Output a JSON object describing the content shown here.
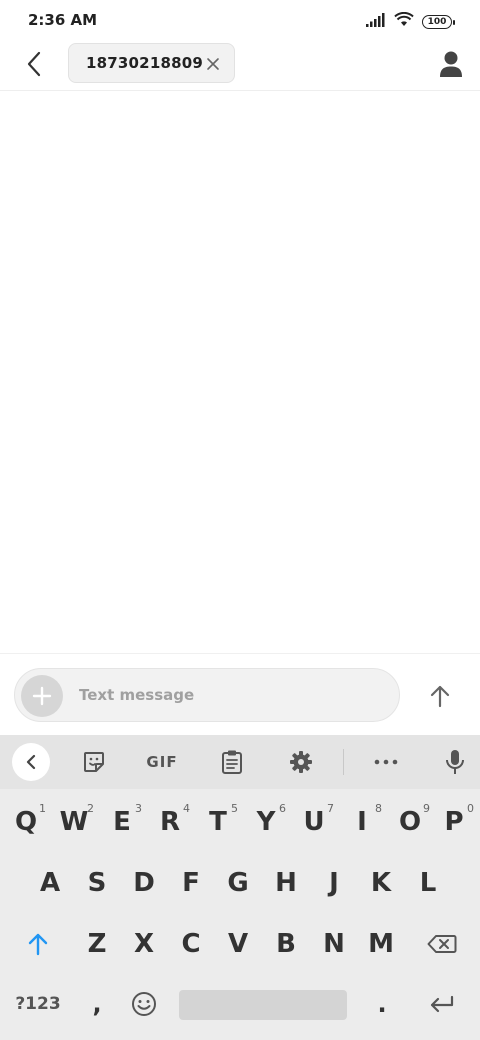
{
  "status_bar": {
    "time": "2:36 AM",
    "battery": "100"
  },
  "header": {
    "recipient": "18730218809"
  },
  "compose": {
    "placeholder": "Text message"
  },
  "keyboard": {
    "toolbar": {
      "gif_label": "GIF"
    },
    "row1": [
      {
        "label": "Q",
        "hint": "1"
      },
      {
        "label": "W",
        "hint": "2"
      },
      {
        "label": "E",
        "hint": "3"
      },
      {
        "label": "R",
        "hint": "4"
      },
      {
        "label": "T",
        "hint": "5"
      },
      {
        "label": "Y",
        "hint": "6"
      },
      {
        "label": "U",
        "hint": "7"
      },
      {
        "label": "I",
        "hint": "8"
      },
      {
        "label": "O",
        "hint": "9"
      },
      {
        "label": "P",
        "hint": "0"
      }
    ],
    "row2": [
      "A",
      "S",
      "D",
      "F",
      "G",
      "H",
      "J",
      "K",
      "L"
    ],
    "row3": [
      "Z",
      "X",
      "C",
      "V",
      "B",
      "N",
      "M"
    ],
    "symbols_label": "?123",
    "comma": ",",
    "period": ".",
    "accent_color": "#2196f3"
  }
}
